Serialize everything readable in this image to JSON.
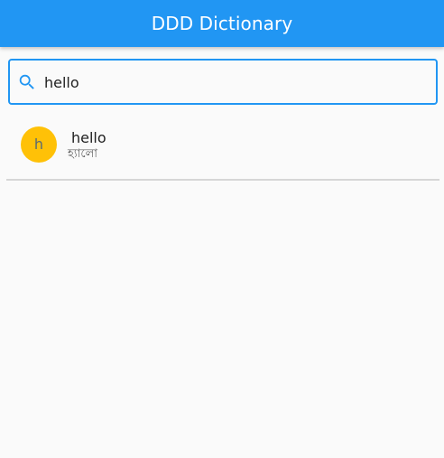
{
  "appbar": {
    "title": "DDD Dictionary",
    "color": "#2196f3"
  },
  "search": {
    "icon": "search-icon",
    "value": "hello",
    "border_color": "#2196f3"
  },
  "results": [
    {
      "avatar_letter": "h",
      "avatar_color": "#ffc107",
      "word": "hello",
      "meaning": "হ্যালো"
    }
  ]
}
